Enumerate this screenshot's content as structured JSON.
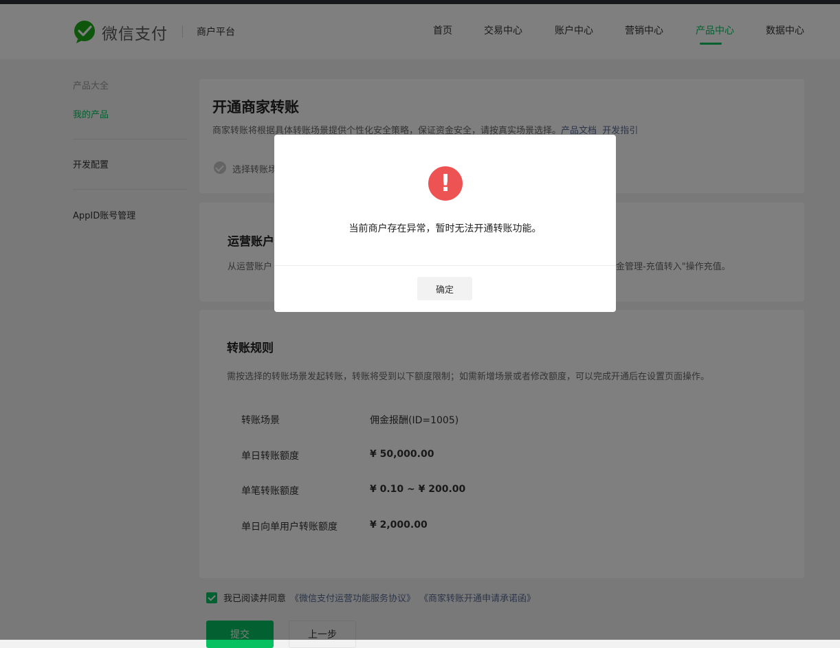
{
  "header": {
    "brand": "微信支付",
    "platform": "商户平台",
    "nav": [
      {
        "label": "首页",
        "active": false
      },
      {
        "label": "交易中心",
        "active": false
      },
      {
        "label": "账户中心",
        "active": false
      },
      {
        "label": "营销中心",
        "active": false
      },
      {
        "label": "产品中心",
        "active": true
      },
      {
        "label": "数据中心",
        "active": false
      }
    ]
  },
  "sidebar": {
    "category": "产品大全",
    "items": [
      {
        "label": "我的产品",
        "active": true
      },
      {
        "label": "开发配置",
        "active": false
      },
      {
        "label": "AppID账号管理",
        "active": false
      }
    ]
  },
  "main": {
    "title": "开通商家转账",
    "desc": "商家转账将根据具体转账场景提供个性化安全策略，保证资金安全，请按真实场景选择。",
    "doc_link": "产品文档",
    "guide_link": "开发指引",
    "step_label": "选择转账场",
    "account": {
      "title": "运营账户",
      "desc_left": "从运营账户",
      "desc_right": "金管理-充值转入\"操作充值。"
    },
    "rules": {
      "title": "转账规则",
      "desc": "需按选择的转账场景发起转账，转账将受到以下额度限制；如需新增场景或者修改额度，可以完成开通后在设置页面操作。",
      "rows": [
        {
          "label": "转账场景",
          "value": "佣金报酬(ID=1005)",
          "bold": false
        },
        {
          "label": "单日转账额度",
          "value": "¥ 50,000.00",
          "bold": true
        },
        {
          "label": "单笔转账额度",
          "value": "¥ 0.10 ~ ¥ 200.00",
          "bold": true
        },
        {
          "label": "单日向单用户转账额度",
          "value": "¥ 2,000.00",
          "bold": true
        }
      ]
    },
    "agree": {
      "prefix": "我已阅读并同意",
      "link1": "《微信支付运营功能服务协议》",
      "link2": "《商家转账开通申请承诺函》"
    },
    "submit_label": "提交",
    "back_label": "上一步"
  },
  "modal": {
    "icon": "!",
    "message": "当前商户存在异常，暂时无法开通转账功能。",
    "confirm_label": "确定"
  },
  "colors": {
    "accent": "#07c160",
    "link": "#576b95",
    "error": "#ee5353"
  }
}
